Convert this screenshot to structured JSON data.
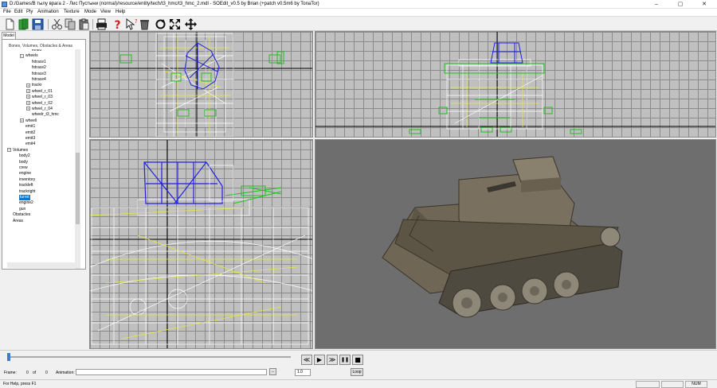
{
  "window": {
    "title": "D:/Games/В тылу врага 2 - Лис Пустыни (normal)/resource/entity/tech/t3_hmc/t3_hmc_2.mdl - SOEdit_v0.5 by Brian (+patch v0.5m6 by TonaTor)",
    "minimize": "–",
    "maximize": "▢",
    "close": "✕"
  },
  "menu": [
    "File",
    "Edit",
    "Ply",
    "Animation",
    "Texture",
    "Mode",
    "View",
    "Help"
  ],
  "toolbar": {
    "icons": [
      "new-file-icon",
      "open-icon",
      "save-icon",
      "cut-icon",
      "copy-icon",
      "paste-icon",
      "print-icon",
      "help-icon",
      "select-arrow-icon",
      "delete-icon",
      "rotate-icon",
      "scale-icon",
      "move-icon"
    ]
  },
  "left_panel": {
    "tab": "Model",
    "group_title": "Bones, Volumes, Obstacles & Areas",
    "tree": [
      {
        "label": "emit0",
        "indent": 3,
        "exp": ""
      },
      {
        "label": "wheels",
        "indent": 2,
        "exp": "−"
      },
      {
        "label": "fxtrace1",
        "indent": 3,
        "exp": ""
      },
      {
        "label": "fxtrace2",
        "indent": 3,
        "exp": ""
      },
      {
        "label": "fxtrace3",
        "indent": 3,
        "exp": ""
      },
      {
        "label": "fxtrace4",
        "indent": 3,
        "exp": ""
      },
      {
        "label": "trackr",
        "indent": 3,
        "exp": "+"
      },
      {
        "label": "wheel_r_01",
        "indent": 3,
        "exp": "+"
      },
      {
        "label": "wheel_r_03",
        "indent": 3,
        "exp": "+"
      },
      {
        "label": "wheel_r_02",
        "indent": 3,
        "exp": "+"
      },
      {
        "label": "wheel_r_04",
        "indent": 3,
        "exp": "+"
      },
      {
        "label": "wheelr_t3_hmc",
        "indent": 3,
        "exp": ""
      },
      {
        "label": "wheell",
        "indent": 2,
        "exp": "+"
      },
      {
        "label": "emit1",
        "indent": 2,
        "exp": ""
      },
      {
        "label": "emit2",
        "indent": 2,
        "exp": ""
      },
      {
        "label": "emit3",
        "indent": 2,
        "exp": ""
      },
      {
        "label": "emit4",
        "indent": 2,
        "exp": ""
      },
      {
        "label": "Volumes",
        "indent": 0,
        "exp": "−"
      },
      {
        "label": "body2",
        "indent": 1,
        "exp": ""
      },
      {
        "label": "body",
        "indent": 1,
        "exp": ""
      },
      {
        "label": "crew",
        "indent": 1,
        "exp": ""
      },
      {
        "label": "engine",
        "indent": 1,
        "exp": ""
      },
      {
        "label": "inventory",
        "indent": 1,
        "exp": ""
      },
      {
        "label": "trackleft",
        "indent": 1,
        "exp": ""
      },
      {
        "label": "trackright",
        "indent": 1,
        "exp": ""
      },
      {
        "label": "turret",
        "indent": 1,
        "exp": "",
        "selected": true
      },
      {
        "label": "engine2",
        "indent": 1,
        "exp": ""
      },
      {
        "label": "gun",
        "indent": 1,
        "exp": ""
      },
      {
        "label": "Obstacles",
        "indent": 0,
        "exp": ""
      },
      {
        "label": "Areas",
        "indent": 0,
        "exp": ""
      }
    ]
  },
  "bottom": {
    "frame_label": "Frame:",
    "frame_value": "0",
    "of_label": "of",
    "frame_total": "0",
    "animation_label": "Animation:",
    "animation_button": "...",
    "speed_value": "1.0",
    "loop_label": "Loop",
    "controls": [
      "rewind",
      "play",
      "fast-forward",
      "pause",
      "stop"
    ],
    "control_glyphs": [
      "≪",
      "▶",
      "≫",
      "❚❚",
      "■"
    ]
  },
  "status": {
    "text": "For Help, press F1",
    "num": "NUM"
  },
  "colors": {
    "accent": "#0078d7",
    "wire_white": "#ffffff",
    "wire_yellow": "#e8e840",
    "wire_green": "#20c020",
    "wire_blue": "#2020e0",
    "persp_bg": "#6e6e6e",
    "tank": "#6f6656"
  }
}
